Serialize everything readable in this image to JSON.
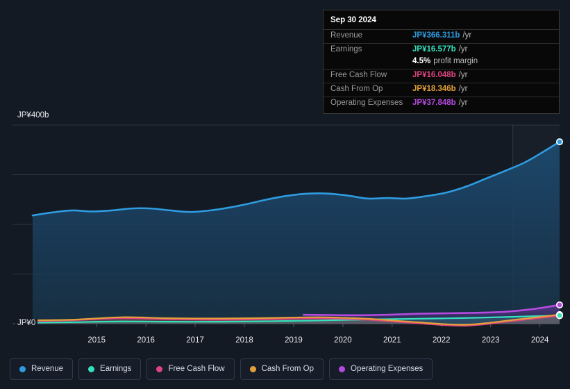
{
  "background": "#141a23",
  "colors": {
    "revenue": "#2e9ce0",
    "earnings": "#35e0bd",
    "free_cash_flow": "#e04480",
    "cash_from_op": "#e3a03a",
    "operating_expenses": "#b44ae0"
  },
  "tooltip": {
    "date": "Sep 30 2024",
    "rows": [
      {
        "name": "Revenue",
        "value": "JP¥366.311b",
        "suffix": "/yr",
        "color": "#2e9ce0"
      },
      {
        "name": "Earnings",
        "value": "JP¥16.577b",
        "suffix": "/yr",
        "color": "#35e0bd"
      },
      {
        "name": "",
        "value": "4.5%",
        "suffix": "profit margin",
        "color": "#ffffff"
      },
      {
        "name": "Free Cash Flow",
        "value": "JP¥16.048b",
        "suffix": "/yr",
        "color": "#e04480"
      },
      {
        "name": "Cash From Op",
        "value": "JP¥18.346b",
        "suffix": "/yr",
        "color": "#e3a03a"
      },
      {
        "name": "Operating Expenses",
        "value": "JP¥37.848b",
        "suffix": "/yr",
        "color": "#b44ae0"
      }
    ]
  },
  "legend": {
    "items": [
      {
        "label": "Revenue",
        "color": "#2e9ce0"
      },
      {
        "label": "Earnings",
        "color": "#35e0bd"
      },
      {
        "label": "Free Cash Flow",
        "color": "#e04480"
      },
      {
        "label": "Cash From Op",
        "color": "#e3a03a"
      },
      {
        "label": "Operating Expenses",
        "color": "#b44ae0"
      }
    ]
  },
  "chart_data": {
    "type": "area",
    "title": "",
    "xlabel": "",
    "ylabel": "",
    "ylim": [
      0,
      400
    ],
    "yunit": "JP¥b",
    "y_axis_labels": [
      "JP¥400b",
      "JP¥0"
    ],
    "gridlines": [
      400,
      300,
      200,
      100,
      0
    ],
    "grid": true,
    "legend_position": "bottom-left",
    "x_tick_labels": [
      "2015",
      "2016",
      "2017",
      "2018",
      "2019",
      "2020",
      "2021",
      "2022",
      "2023",
      "2024"
    ],
    "x_start": 2014.2,
    "x_end": 2024.9,
    "forecast_divider_x": 2023.95,
    "series": [
      {
        "name": "Revenue",
        "color": "#2e9ce0",
        "filled": true,
        "x": [
          2014.2,
          2014.6,
          2015.0,
          2015.4,
          2015.8,
          2016.2,
          2016.6,
          2017.0,
          2017.4,
          2017.8,
          2018.2,
          2018.6,
          2019.0,
          2019.4,
          2019.8,
          2020.2,
          2020.6,
          2021.0,
          2021.4,
          2021.8,
          2022.2,
          2022.6,
          2023.0,
          2023.4,
          2023.8,
          2024.2,
          2024.6,
          2024.9
        ],
        "values": [
          218,
          224,
          228,
          226,
          228,
          232,
          232,
          228,
          225,
          228,
          234,
          242,
          251,
          258,
          262,
          262,
          258,
          252,
          253,
          252,
          257,
          264,
          276,
          292,
          308,
          325,
          348,
          366.311
        ]
      },
      {
        "name": "Earnings",
        "color": "#35e0bd",
        "filled": false,
        "x": [
          2014.2,
          2015.0,
          2016.0,
          2017.0,
          2018.0,
          2019.0,
          2020.0,
          2021.0,
          2022.0,
          2023.0,
          2024.0,
          2024.9
        ],
        "values": [
          2.0,
          3.0,
          4.5,
          4.0,
          4.0,
          5.0,
          6.5,
          8.5,
          10.0,
          11.5,
          14.0,
          16.577
        ]
      },
      {
        "name": "Free Cash Flow",
        "color": "#e04480",
        "filled": false,
        "x": [
          2014.2,
          2015.0,
          2016.0,
          2017.0,
          2018.0,
          2019.0,
          2020.0,
          2021.0,
          2022.0,
          2023.0,
          2024.0,
          2024.9
        ],
        "values": [
          5.0,
          7.0,
          11.0,
          9.0,
          8.0,
          9.0,
          11.0,
          8.0,
          1.0,
          -4.0,
          6.0,
          16.048
        ]
      },
      {
        "name": "Cash From Op",
        "color": "#e3a03a",
        "filled": false,
        "x": [
          2014.2,
          2015.0,
          2016.0,
          2017.0,
          2018.0,
          2019.0,
          2020.0,
          2021.0,
          2022.0,
          2023.0,
          2024.0,
          2024.9
        ],
        "values": [
          7.0,
          8.0,
          13.0,
          11.0,
          10.5,
          11.5,
          13.0,
          10.0,
          3.0,
          -2.0,
          8.0,
          18.346
        ]
      },
      {
        "name": "Operating Expenses",
        "color": "#b44ae0",
        "filled": false,
        "x": [
          2019.7,
          2020.2,
          2020.8,
          2021.4,
          2022.0,
          2022.6,
          2023.2,
          2023.8,
          2024.4,
          2024.9
        ],
        "values": [
          18.0,
          17.5,
          17.0,
          18.0,
          20.0,
          21.0,
          22.0,
          24.0,
          30.0,
          37.848
        ]
      }
    ]
  }
}
